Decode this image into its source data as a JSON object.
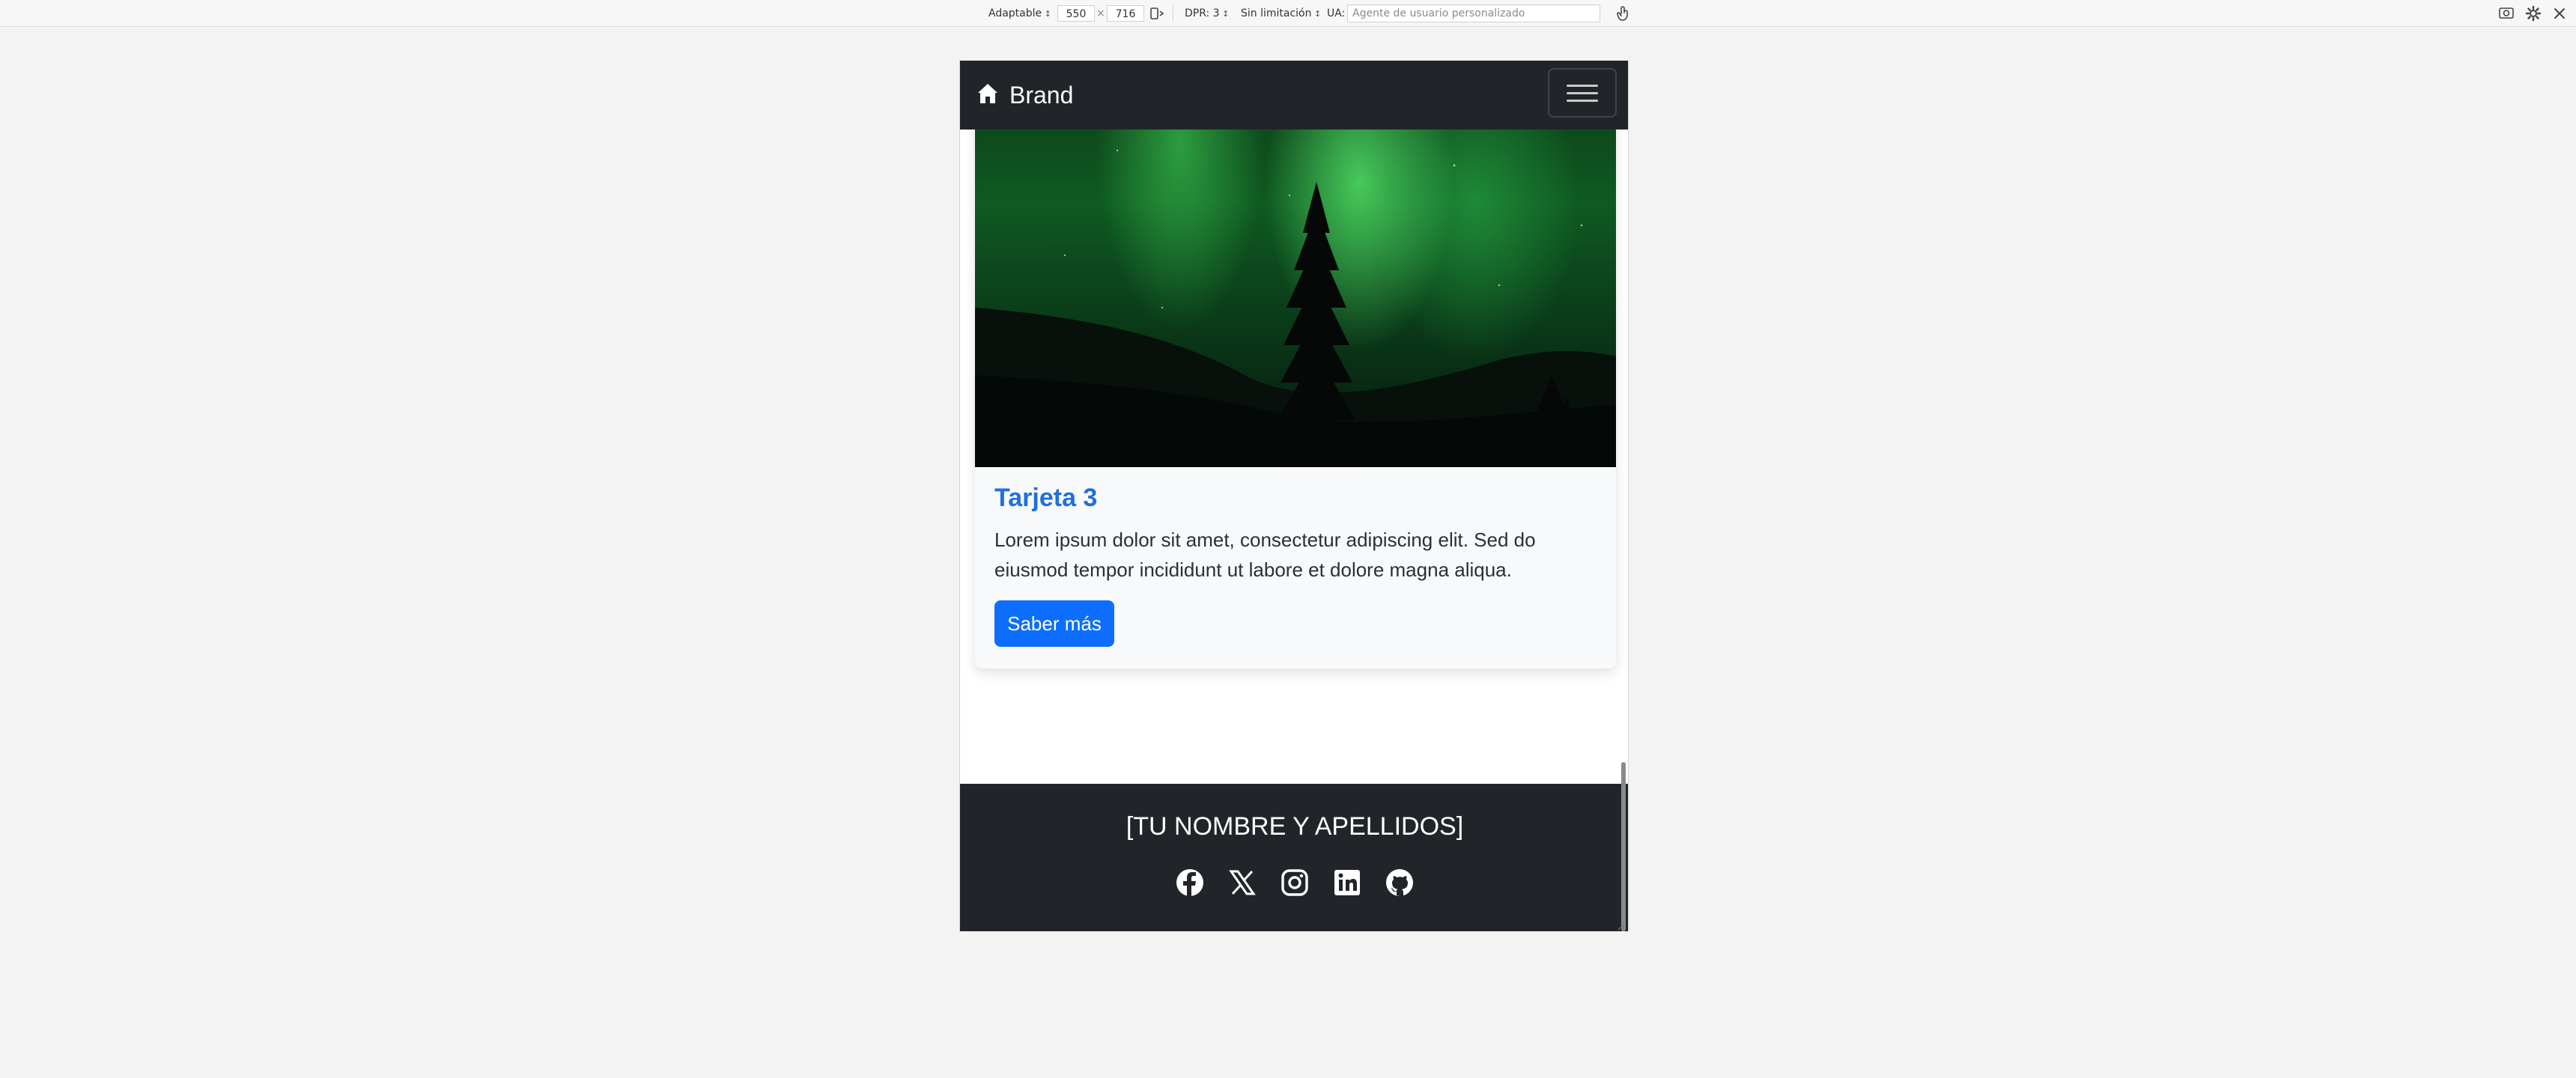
{
  "devtools": {
    "device_mode": "Adaptable",
    "width": "550",
    "times": "×",
    "height": "716",
    "dpr": "DPR: 3",
    "throttling": "Sin limitación",
    "ua_label": "UA:",
    "ua_placeholder": "Agente de usuario personalizado"
  },
  "navbar": {
    "brand": "Brand"
  },
  "card": {
    "title": "Tarjeta 3",
    "text": "Lorem ipsum dolor sit amet, consectetur adipiscing elit. Sed do eiusmod tempor incididunt ut labore et dolore magna aliqua.",
    "button": "Saber más"
  },
  "footer": {
    "name": "[TU NOMBRE Y APELLIDOS]",
    "socials": [
      "facebook-icon",
      "x-icon",
      "instagram-icon",
      "linkedin-icon",
      "github-icon"
    ]
  }
}
